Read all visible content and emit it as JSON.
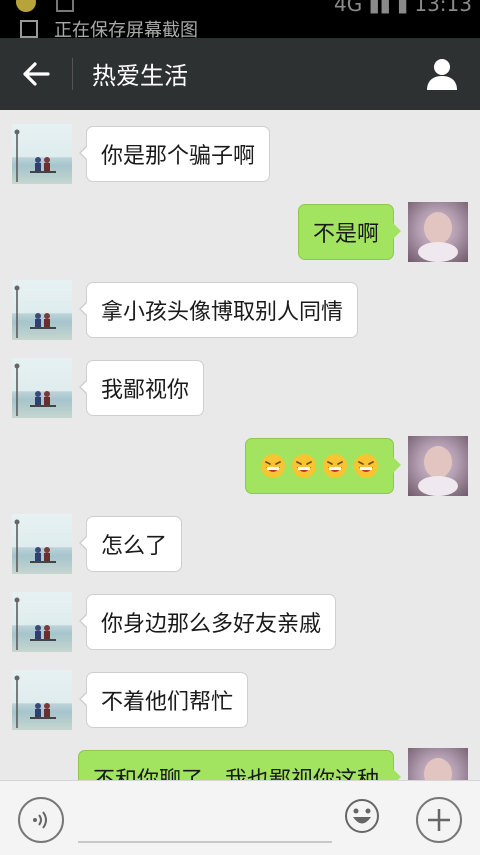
{
  "status_bar": {
    "notification": "正在保存屏幕截图",
    "network": "4G",
    "time": "13:13"
  },
  "header": {
    "back_icon": "back-arrow-icon",
    "title": "热爱生活",
    "profile_icon": "person-icon"
  },
  "messages": [
    {
      "side": "left",
      "text": "你是那个骗子啊"
    },
    {
      "side": "right",
      "text": "不是啊"
    },
    {
      "side": "left",
      "text": "拿小孩头像博取别人同情"
    },
    {
      "side": "left",
      "text": "我鄙视你"
    },
    {
      "side": "right",
      "emoji": [
        "grin-sweat-icon",
        "grin-sweat-icon",
        "grin-sweat-icon",
        "grin-sweat-icon"
      ]
    },
    {
      "side": "left",
      "text": "怎么了"
    },
    {
      "side": "left",
      "text": "你身边那么多好友亲戚"
    },
    {
      "side": "left",
      "text": "不着他们帮忙"
    },
    {
      "side": "right",
      "text": "不和你聊了，我也鄙视你这种"
    }
  ],
  "input_bar": {
    "voice_icon": "voice-icon",
    "input_value": "",
    "emoji_icon": "emoji-icon",
    "plus_icon": "plus-icon"
  },
  "colors": {
    "header_bg": "#2e3132",
    "chat_bg": "#e9e9e9",
    "my_bubble": "#a2e35f",
    "their_bubble": "#ffffff"
  }
}
